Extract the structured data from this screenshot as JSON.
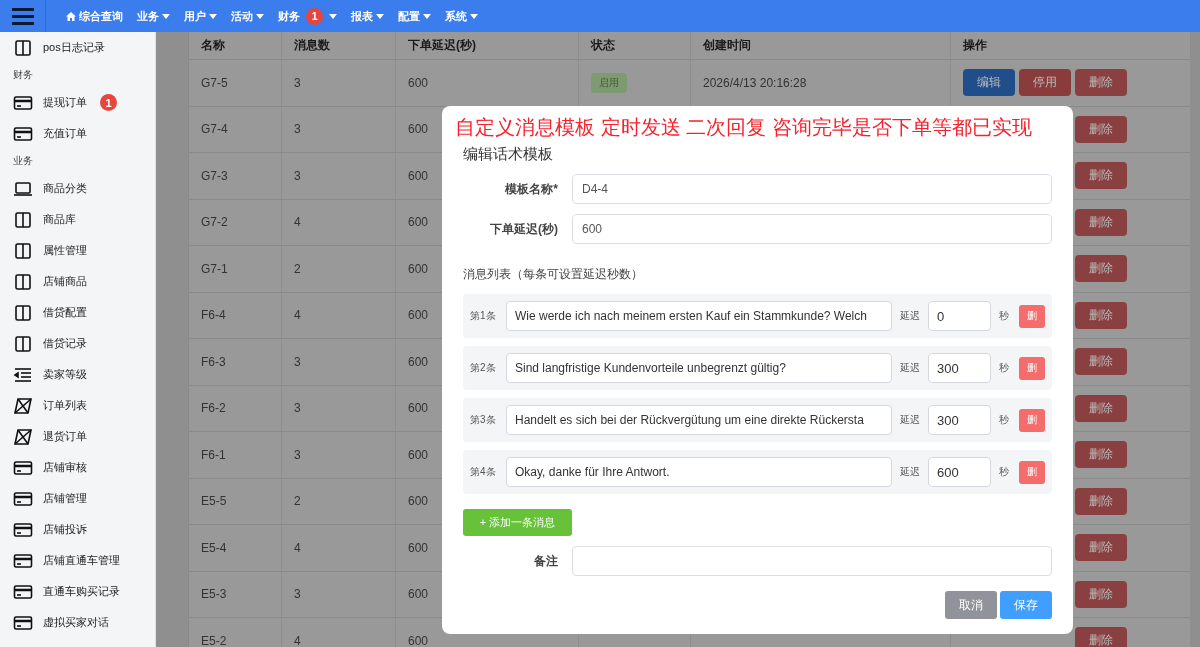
{
  "nav": {
    "items": [
      {
        "label": "综合查询",
        "kind": "home"
      },
      {
        "label": "业务",
        "kind": "dropdown"
      },
      {
        "label": "用户",
        "kind": "dropdown"
      },
      {
        "label": "活动",
        "kind": "dropdown"
      },
      {
        "label": "财务",
        "kind": "dropdown",
        "badge": "1"
      },
      {
        "label": "报表",
        "kind": "dropdown"
      },
      {
        "label": "配置",
        "kind": "dropdown"
      },
      {
        "label": "系统",
        "kind": "dropdown"
      }
    ]
  },
  "sidebar": {
    "items": [
      {
        "label": "pos日志记录",
        "kind": "columns"
      },
      {
        "label": "财务",
        "kind": "section"
      },
      {
        "label": "提现订单",
        "kind": "card",
        "badge": "1"
      },
      {
        "label": "充值订单",
        "kind": "card"
      },
      {
        "label": "业务",
        "kind": "section"
      },
      {
        "label": "商品分类",
        "kind": "laptop"
      },
      {
        "label": "商品库",
        "kind": "columns"
      },
      {
        "label": "属性管理",
        "kind": "columns"
      },
      {
        "label": "店铺商品",
        "kind": "columns"
      },
      {
        "label": "借贷配置",
        "kind": "columns"
      },
      {
        "label": "借贷记录",
        "kind": "columns"
      },
      {
        "label": "卖家等级",
        "kind": "indent"
      },
      {
        "label": "订单列表",
        "kind": "crossed"
      },
      {
        "label": "退货订单",
        "kind": "crossed"
      },
      {
        "label": "店铺审核",
        "kind": "card"
      },
      {
        "label": "店铺管理",
        "kind": "card"
      },
      {
        "label": "店铺投诉",
        "kind": "card"
      },
      {
        "label": "店铺直通车管理",
        "kind": "card"
      },
      {
        "label": "直通车购买记录",
        "kind": "card"
      },
      {
        "label": "虚拟买家对话",
        "kind": "card"
      }
    ]
  },
  "table": {
    "columns": [
      "名称",
      "消息数",
      "下单延迟(秒)",
      "状态",
      "创建时间",
      "操作"
    ],
    "rows": [
      {
        "name": "G7-5",
        "count": "3",
        "delay": "600",
        "status": "启用",
        "created": "2026/4/13 20:16:28",
        "actions": [
          {
            "label": "编辑",
            "kind": "edit"
          },
          {
            "label": "停用",
            "kind": "disable"
          },
          {
            "label": "删除",
            "kind": "delete"
          }
        ]
      },
      {
        "name": "G7-4",
        "count": "3",
        "delay": "600",
        "actions": [
          {
            "label": "删除",
            "kind": "delete"
          }
        ]
      },
      {
        "name": "G7-3",
        "count": "3",
        "delay": "600",
        "actions": [
          {
            "label": "删除",
            "kind": "delete"
          }
        ]
      },
      {
        "name": "G7-2",
        "count": "4",
        "delay": "600",
        "actions": [
          {
            "label": "删除",
            "kind": "delete"
          }
        ]
      },
      {
        "name": "G7-1",
        "count": "2",
        "delay": "600",
        "actions": [
          {
            "label": "删除",
            "kind": "delete"
          }
        ]
      },
      {
        "name": "F6-4",
        "count": "4",
        "delay": "600",
        "actions": [
          {
            "label": "删除",
            "kind": "delete"
          }
        ]
      },
      {
        "name": "F6-3",
        "count": "3",
        "delay": "600",
        "actions": [
          {
            "label": "删除",
            "kind": "delete"
          }
        ]
      },
      {
        "name": "F6-2",
        "count": "3",
        "delay": "600",
        "actions": [
          {
            "label": "删除",
            "kind": "delete"
          }
        ]
      },
      {
        "name": "F6-1",
        "count": "3",
        "delay": "600",
        "actions": [
          {
            "label": "删除",
            "kind": "delete"
          }
        ]
      },
      {
        "name": "E5-5",
        "count": "2",
        "delay": "600",
        "actions": [
          {
            "label": "删除",
            "kind": "delete"
          }
        ]
      },
      {
        "name": "E5-4",
        "count": "4",
        "delay": "600",
        "actions": [
          {
            "label": "删除",
            "kind": "delete"
          }
        ]
      },
      {
        "name": "E5-3",
        "count": "3",
        "delay": "600",
        "actions": [
          {
            "label": "删除",
            "kind": "delete"
          }
        ]
      },
      {
        "name": "E5-2",
        "count": "4",
        "delay": "600",
        "actions": [
          {
            "label": "删除",
            "kind": "delete"
          }
        ]
      }
    ]
  },
  "modal": {
    "banner": "自定义消息模板 定时发送 二次回复 咨询完毕是否下单等都已实现",
    "title": "编辑话术模板",
    "fields": [
      {
        "label": "模板名称*",
        "value": "D4-4"
      },
      {
        "label": "下单延迟(秒)",
        "value": "600"
      }
    ],
    "messages_heading": "消息列表（每条可设置延迟秒数）",
    "messages": [
      {
        "index_label": "第1条",
        "text": "Wie werde ich nach meinem ersten Kauf ein Stammkunde? Welch",
        "delay_label": "延迟",
        "delay": "0",
        "unit": "秒",
        "delete": "删"
      },
      {
        "index_label": "第2条",
        "text": "Sind langfristige Kundenvorteile unbegrenzt gültig?",
        "delay_label": "延迟",
        "delay": "300",
        "unit": "秒",
        "delete": "删"
      },
      {
        "index_label": "第3条",
        "text": "Handelt es sich bei der Rückvergütung um eine direkte Rückersta",
        "delay_label": "延迟",
        "delay": "300",
        "unit": "秒",
        "delete": "删"
      },
      {
        "index_label": "第4条",
        "text": "Okay, danke für Ihre Antwort.",
        "delay_label": "延迟",
        "delay": "600",
        "unit": "秒",
        "delete": "删"
      }
    ],
    "add_button": "+ 添加一条消息",
    "note": {
      "label": "备注"
    },
    "buttons": [
      {
        "label": "取消",
        "kind": "cancel"
      },
      {
        "label": "保存",
        "kind": "primary"
      }
    ]
  }
}
